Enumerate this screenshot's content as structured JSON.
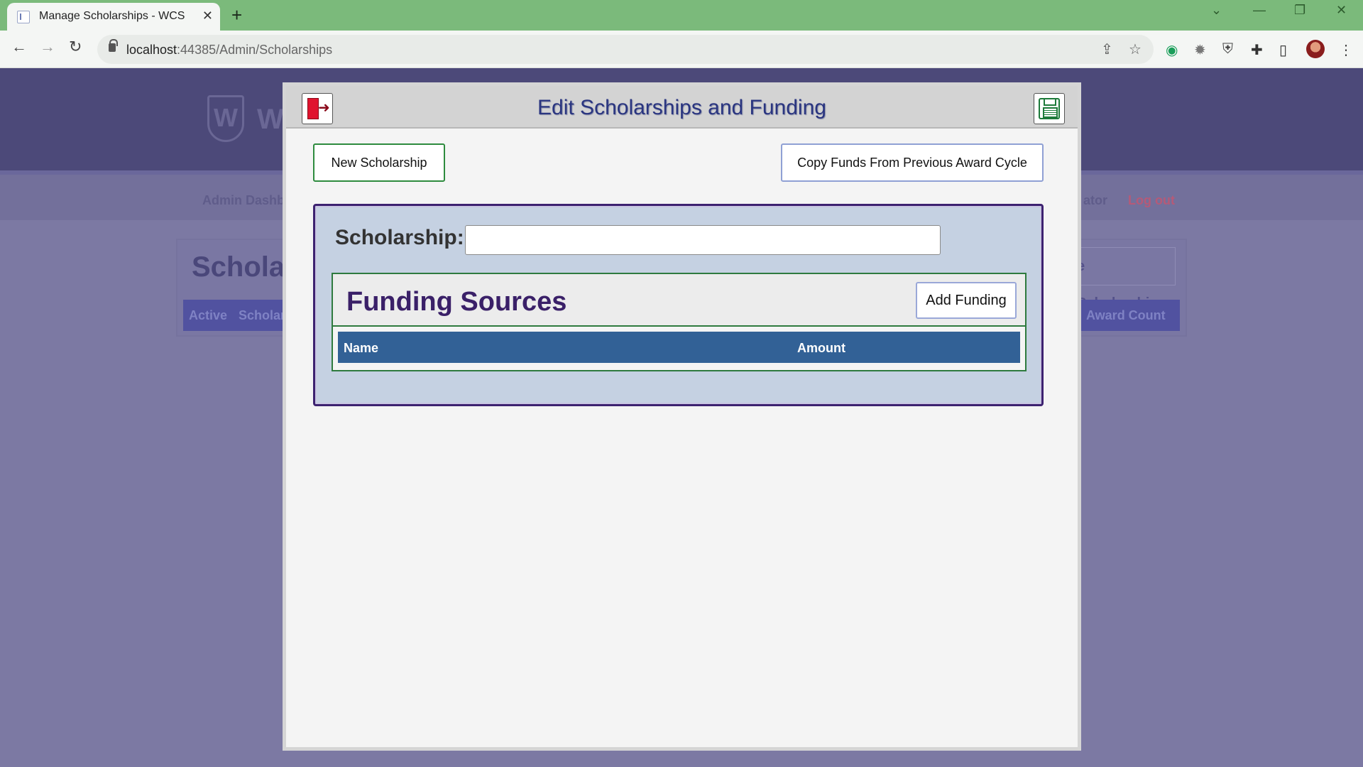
{
  "browser": {
    "tab_title": "Manage Scholarships - WCS",
    "new_tab_symbol": "+",
    "close_tab_symbol": "✕",
    "url_host": "localhost",
    "url_rest": ":44385/Admin/Scholarships",
    "window_controls": {
      "chevron": "⌄",
      "minimize": "—",
      "restore": "❐",
      "close": "✕"
    }
  },
  "background_page": {
    "brand_initial": "W",
    "brand_partial": "W",
    "nav_left_partial": "Admin Dashb",
    "nav_right_partial": "ator",
    "nav_logout": "Log out",
    "title_partial": "Scholar",
    "manage_partial": "e Scholarships",
    "table_headers_left": [
      "Active",
      "Scholar"
    ],
    "table_header_right": "Award Count"
  },
  "modal": {
    "title": "Edit Scholarships and Funding",
    "new_scholarship_label": "New Scholarship",
    "copy_funds_label": "Copy Funds From Previous Award Cycle",
    "scholarship_label": "Scholarship:",
    "scholarship_value": "",
    "funding": {
      "title": "Funding Sources",
      "add_label": "Add Funding",
      "columns": [
        "Name",
        "Amount"
      ]
    }
  },
  "colors": {
    "tabbar": "#7bba7b",
    "header_bg": "#4c4979",
    "modal_title": "#2a3580",
    "table_header": "#326196",
    "panel_border": "#3d2270",
    "funding_border": "#2e7a3e"
  }
}
